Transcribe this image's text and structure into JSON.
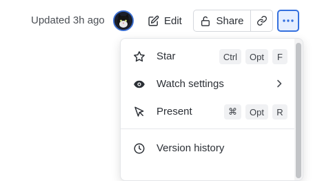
{
  "header": {
    "updated_text": "Updated 3h ago",
    "edit_label": "Edit",
    "share_label": "Share"
  },
  "menu": {
    "items": [
      {
        "label": "Star",
        "icon": "star-icon",
        "shortcut": [
          "Ctrl",
          "Opt",
          "F"
        ]
      },
      {
        "label": "Watch settings",
        "icon": "eye-icon",
        "submenu": true
      },
      {
        "label": "Present",
        "icon": "cursor-pointer-icon",
        "shortcut": [
          "⌘",
          "Opt",
          "R"
        ]
      },
      {
        "label": "Version history",
        "icon": "clock-icon"
      }
    ]
  },
  "colors": {
    "accent": "#3470de",
    "accent_bg": "#e6efff"
  }
}
